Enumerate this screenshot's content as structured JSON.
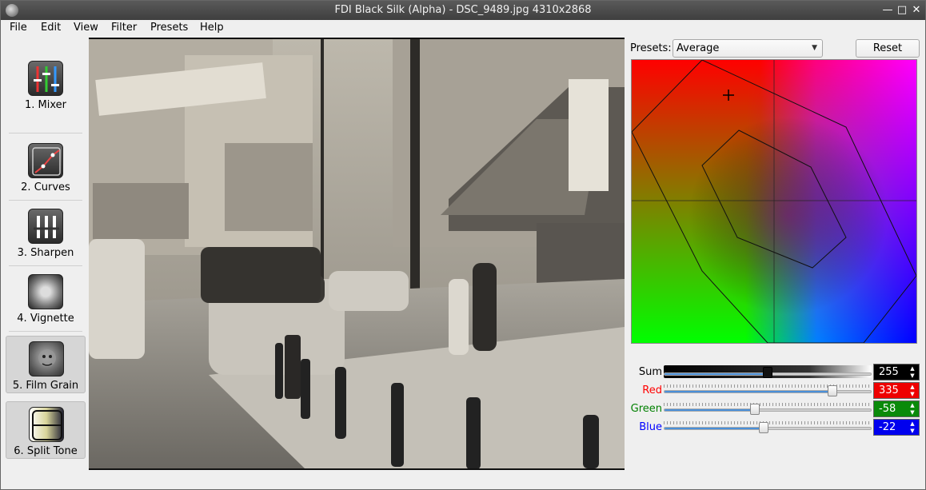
{
  "window": {
    "title": "FDI Black Silk (Alpha) - DSC_9489.jpg 4310x2868"
  },
  "menu": {
    "file": "File",
    "edit": "Edit",
    "view": "View",
    "filter": "Filter",
    "presets": "Presets",
    "help": "Help"
  },
  "tools": [
    {
      "label": "1. Mixer",
      "icon": "mixer-icon",
      "selected": false
    },
    {
      "label": "2. Curves",
      "icon": "curves-icon",
      "selected": false
    },
    {
      "label": "3. Sharpen",
      "icon": "sharpen-icon",
      "selected": false
    },
    {
      "label": "4. Vignette",
      "icon": "vignette-icon",
      "selected": false
    },
    {
      "label": "5. Film Grain",
      "icon": "film-grain-icon",
      "selected": true
    },
    {
      "label": "6. Split Tone",
      "icon": "split-tone-icon",
      "selected": true
    }
  ],
  "mixer": {
    "presets_label": "Presets:",
    "preset_value": "Average",
    "reset_label": "Reset",
    "sliders": [
      {
        "name": "Sum",
        "value": "255",
        "color": "#000000",
        "text_color": "#000000",
        "level": 0.5
      },
      {
        "name": "Red",
        "value": "335",
        "color": "#ff0000",
        "text_color": "#ff0000",
        "level": 0.81
      },
      {
        "name": "Green",
        "value": "-58",
        "color": "#008000",
        "text_color": "#008000",
        "level": 0.44
      },
      {
        "name": "Blue",
        "value": "-22",
        "color": "#0000ff",
        "text_color": "#0000ff",
        "level": 0.48
      }
    ]
  }
}
